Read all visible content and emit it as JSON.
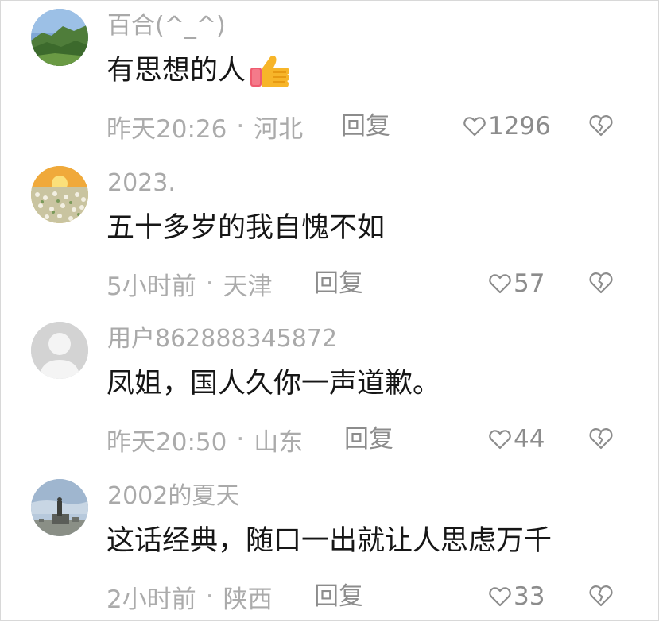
{
  "comments": [
    {
      "username": "百合(^_^)",
      "text": "有思想的人",
      "time": "昨天20:26",
      "location": "河北",
      "reply_label": "回复",
      "likes": "1296",
      "avatar_icon": "mountain-landscape-avatar"
    },
    {
      "username": "2023.",
      "text": "五十多岁的我自愧不如",
      "time": "5小时前",
      "location": "天津",
      "reply_label": "回复",
      "likes": "57",
      "avatar_icon": "sunset-flower-field-avatar"
    },
    {
      "username": "用户862888345872",
      "text": "凤姐，国人久你一声道歉。",
      "time": "昨天20:50",
      "location": "山东",
      "reply_label": "回复",
      "likes": "44",
      "avatar_icon": "default-user-avatar"
    },
    {
      "username": "2002的夏天",
      "text": "这话经典，随口一出就让人思虑万千",
      "time": "2小时前",
      "location": "陕西",
      "reply_label": "回复",
      "likes": "33",
      "avatar_icon": "monument-sky-avatar"
    }
  ],
  "separator": "·",
  "icons": {
    "like": "heart-outline-icon",
    "dislike": "broken-heart-icon",
    "emoji": "thumbs-up-emoji"
  },
  "colors": {
    "username": "#a9a9a9",
    "content": "#161616",
    "meta": "#ababab",
    "action": "#8c8c8c"
  }
}
